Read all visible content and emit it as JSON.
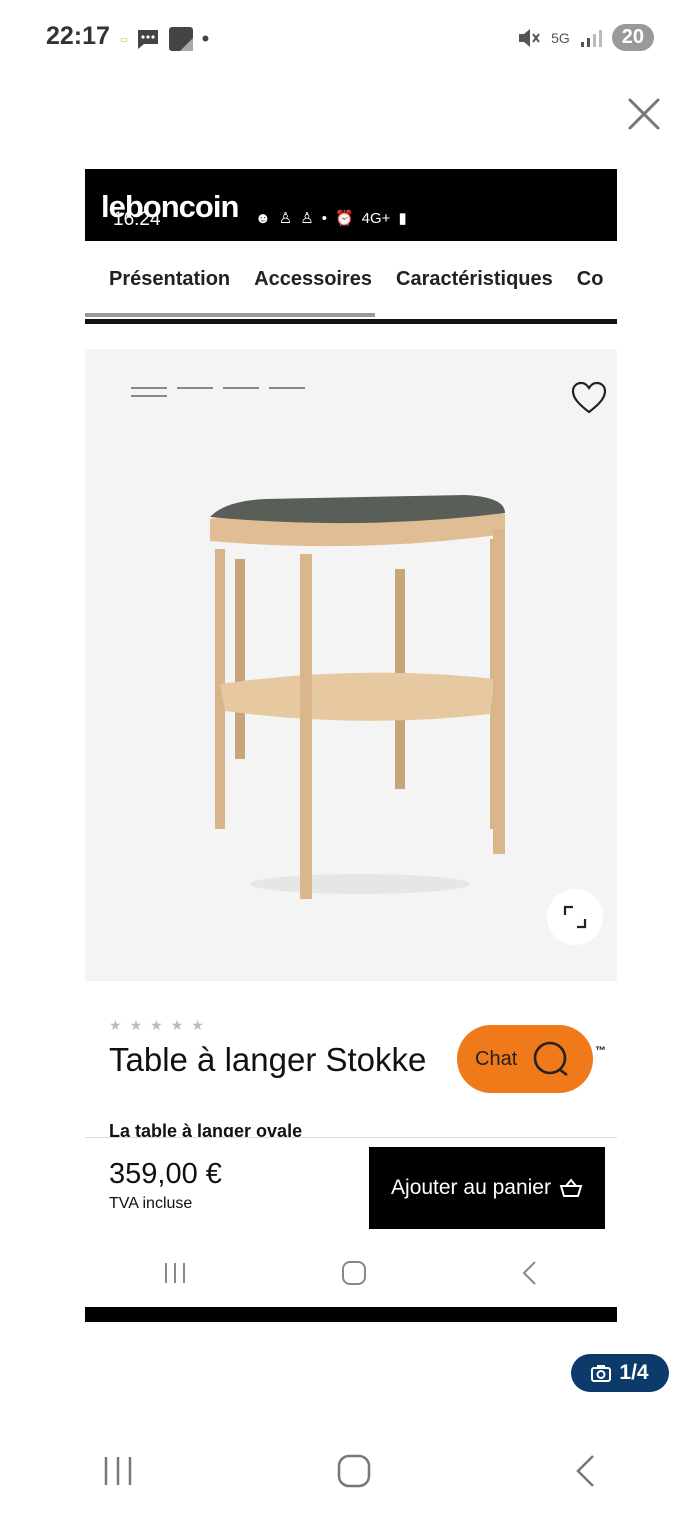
{
  "status_bar": {
    "time": "22:17",
    "battery": "20",
    "network": "5G"
  },
  "viewer": {
    "close_label": "×",
    "counter": "1/4"
  },
  "screenshot": {
    "logo": "leboncoin",
    "inner_time": "16:24",
    "inner_network": "4G+",
    "tabs": [
      "Présentation",
      "Accessoires",
      "Caractéristiques",
      "Co"
    ],
    "product": {
      "title": "Table à langer Stokke",
      "trademark": "™",
      "subtitle": "La table à langer ovale",
      "price": "359,00 €",
      "tax_note": "TVA incluse",
      "rating_stars": 5
    },
    "chat_label": "Chat",
    "cart_button": "Ajouter au panier"
  },
  "colors": {
    "chat_orange": "#f07a1a",
    "counter_blue": "#0c3a6a"
  },
  "icons": [
    "close-icon",
    "heart-icon",
    "expand-icon",
    "chat-icon",
    "basket-icon",
    "camera-icon",
    "recents-icon",
    "home-icon",
    "back-icon"
  ]
}
